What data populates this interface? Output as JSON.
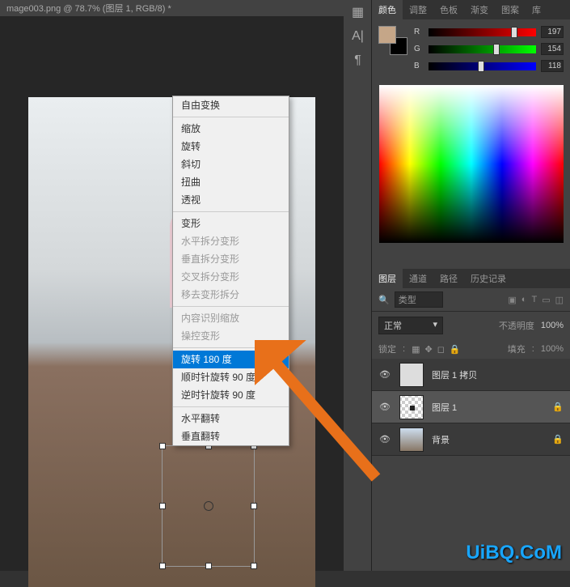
{
  "tab": {
    "title": "mage003.png @ 78.7% (图层 1, RGB/8) *"
  },
  "context_menu": {
    "items": [
      {
        "label": "自由变换",
        "type": "item"
      },
      {
        "type": "sep"
      },
      {
        "label": "缩放",
        "type": "item"
      },
      {
        "label": "旋转",
        "type": "item"
      },
      {
        "label": "斜切",
        "type": "item"
      },
      {
        "label": "扭曲",
        "type": "item"
      },
      {
        "label": "透视",
        "type": "item"
      },
      {
        "type": "sep"
      },
      {
        "label": "变形",
        "type": "item"
      },
      {
        "label": "水平拆分变形",
        "type": "item",
        "disabled": true
      },
      {
        "label": "垂直拆分变形",
        "type": "item",
        "disabled": true
      },
      {
        "label": "交叉拆分变形",
        "type": "item",
        "disabled": true
      },
      {
        "label": "移去变形拆分",
        "type": "item",
        "disabled": true
      },
      {
        "type": "sep"
      },
      {
        "label": "内容识别缩放",
        "type": "item",
        "disabled": true
      },
      {
        "label": "操控变形",
        "type": "item",
        "disabled": true
      },
      {
        "type": "sep"
      },
      {
        "label": "旋转 180 度",
        "type": "item",
        "highlighted": true
      },
      {
        "label": "顺时针旋转 90 度",
        "type": "item"
      },
      {
        "label": "逆时针旋转 90 度",
        "type": "item"
      },
      {
        "type": "sep"
      },
      {
        "label": "水平翻转",
        "type": "item"
      },
      {
        "label": "垂直翻转",
        "type": "item"
      }
    ]
  },
  "color_panel": {
    "tabs": [
      "颜色",
      "调整",
      "色板",
      "渐变",
      "图案",
      "库"
    ],
    "active_tab": "颜色",
    "foreground": "#c5a688",
    "r": {
      "label": "R",
      "value": "197",
      "percent": 77
    },
    "g": {
      "label": "G",
      "value": "154",
      "percent": 60
    },
    "b": {
      "label": "B",
      "value": "118",
      "percent": 46
    }
  },
  "layers_panel": {
    "tabs": [
      "图层",
      "通道",
      "路径",
      "历史记录"
    ],
    "active_tab": "图层",
    "filter_label": "类型",
    "blend_mode": "正常",
    "opacity_label": "不透明度",
    "opacity_value": "100%",
    "lock_label": "锁定",
    "fill_label": "填充",
    "fill_value": "100%",
    "layers": [
      {
        "name": "图层 1 拷贝",
        "visible": true,
        "locked": false,
        "thumb": "transparent",
        "selected": false
      },
      {
        "name": "图层 1",
        "visible": true,
        "locked": true,
        "thumb": "checker",
        "selected": true
      },
      {
        "name": "背景",
        "visible": true,
        "locked": true,
        "thumb": "image",
        "selected": false
      }
    ]
  },
  "icons": {
    "search": "🔍",
    "eye": "👁",
    "lock": "🔒"
  },
  "watermark": "UiBQ.CoM"
}
